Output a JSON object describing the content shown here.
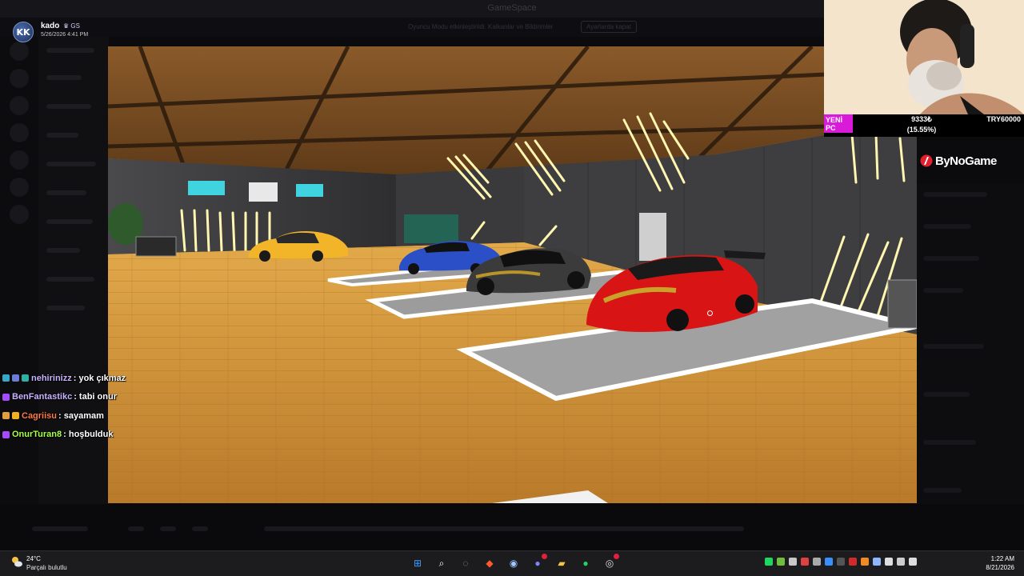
{
  "stream": {
    "user_initials": "KK",
    "user_name": "kado",
    "user_badge": "♛ GS",
    "timestamp": "5/26/2026 4:41 PM"
  },
  "goal_bar": {
    "label": "YENİ PC",
    "current": "9333₺",
    "percent_text": "(15.55%)",
    "target": "TRY60000",
    "progress": 0.1555,
    "accent_color": "#d91ad9"
  },
  "sponsor": {
    "name": "ByNoGame",
    "icon": "bynogame-logo-icon"
  },
  "chat": [
    {
      "user": "nehirinizz",
      "message": " : yok çıkmaz",
      "color": "#c9b3ff",
      "badges": [
        "#3aa7c9",
        "#6a7bd8",
        "#2fb0a5"
      ]
    },
    {
      "user": "BenFantastikc",
      "message": " : tabi onur",
      "color": "#c9b3ff",
      "badges": [
        "#a34cff"
      ]
    },
    {
      "user": "Cagriisu",
      "message": " : sayamam",
      "color": "#ff7a45",
      "badges": [
        "#e0a040",
        "#f0b020"
      ]
    },
    {
      "user": "OnurTuran8",
      "message": " : hoşbulduk",
      "color": "#a6ff4d",
      "badges": [
        "#a34cff"
      ]
    }
  ],
  "background": {
    "title": "GameSpace",
    "banner_text": "Oyuncu Modu etkinleştirildi. Kalkanlar ve Bildirimler",
    "banner_pill": "Ayarlarda kapat"
  },
  "taskbar": {
    "temperature": "24°C",
    "weather": "Parçalı bulutlu",
    "time": "1:22 AM",
    "date": "8/21/2026",
    "apps": [
      {
        "name": "windows-start-icon",
        "glyph": "⊞",
        "color": "#3aa0ff"
      },
      {
        "name": "search-icon",
        "glyph": "⌕",
        "color": "#ffffff"
      },
      {
        "name": "app-circle-icon",
        "glyph": "◌",
        "color": "#9a9aa0"
      },
      {
        "name": "brave-browser-icon",
        "glyph": "◆",
        "color": "#ff5a2c"
      },
      {
        "name": "steam-icon",
        "glyph": "◉",
        "color": "#9ec6ff"
      },
      {
        "name": "discord-icon",
        "glyph": "●",
        "color": "#7d85ff"
      },
      {
        "name": "file-explorer-icon",
        "glyph": "▰",
        "color": "#f5c542"
      },
      {
        "name": "spotify-icon",
        "glyph": "●",
        "color": "#1ed760"
      },
      {
        "name": "chrome-icon",
        "glyph": "◎",
        "color": "#dddddd"
      }
    ]
  }
}
